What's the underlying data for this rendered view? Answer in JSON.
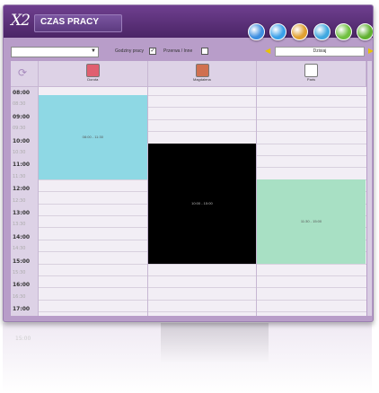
{
  "app": {
    "logo": "X2",
    "title": "CZAS PRACY"
  },
  "toolbar_icons": [
    {
      "name": "disc-icon",
      "color": "#3d8ee0"
    },
    {
      "name": "gear-icon",
      "color": "#3aa0e8"
    },
    {
      "name": "people-icon",
      "color": "#e0a030"
    },
    {
      "name": "chat-icon",
      "color": "#40a8e0"
    },
    {
      "name": "export-icon",
      "color": "#70c040"
    },
    {
      "name": "exit-icon",
      "color": "#60b030"
    }
  ],
  "filters": {
    "select_value": "",
    "working_hours_label": "Godziny pracy",
    "working_hours_checked": true,
    "breaks_label": "Przerwa / Inne",
    "breaks_checked": false,
    "date_label": "Dzisiaj"
  },
  "columns": [
    {
      "label": "Dorota",
      "icon": "heart-icon",
      "color": "#e06070"
    },
    {
      "label": "Magdalena",
      "icon": "pattern-icon",
      "color": "#d07050"
    },
    {
      "label": "Paris",
      "icon": "tower-icon",
      "color": "#ffffff"
    }
  ],
  "time_slots": [
    {
      "label": "08:00",
      "major": true
    },
    {
      "label": "08:30",
      "major": false
    },
    {
      "label": "09:00",
      "major": true
    },
    {
      "label": "09:30",
      "major": false
    },
    {
      "label": "10:00",
      "major": true
    },
    {
      "label": "10:30",
      "major": false
    },
    {
      "label": "11:00",
      "major": true
    },
    {
      "label": "11:30",
      "major": false
    },
    {
      "label": "12:00",
      "major": true
    },
    {
      "label": "12:30",
      "major": false
    },
    {
      "label": "13:00",
      "major": true
    },
    {
      "label": "13:30",
      "major": false
    },
    {
      "label": "14:00",
      "major": true
    },
    {
      "label": "14:30",
      "major": false
    },
    {
      "label": "15:00",
      "major": true
    },
    {
      "label": "15:30",
      "major": false
    },
    {
      "label": "16:00",
      "major": true
    },
    {
      "label": "16:30",
      "major": false
    },
    {
      "label": "17:00",
      "major": true
    }
  ],
  "events": [
    {
      "column": 0,
      "label": "08:00 - 11:30",
      "color": "#8ed8e4",
      "text_color": "#555555"
    },
    {
      "column": 1,
      "label": "10:00 - 15:00",
      "color": "#000000",
      "text_color": "#bbbbbb"
    },
    {
      "column": 2,
      "label": "11:30 - 15:00",
      "color": "#a8e0c4",
      "text_color": "#555555"
    }
  ],
  "reflection_time": "15:00"
}
